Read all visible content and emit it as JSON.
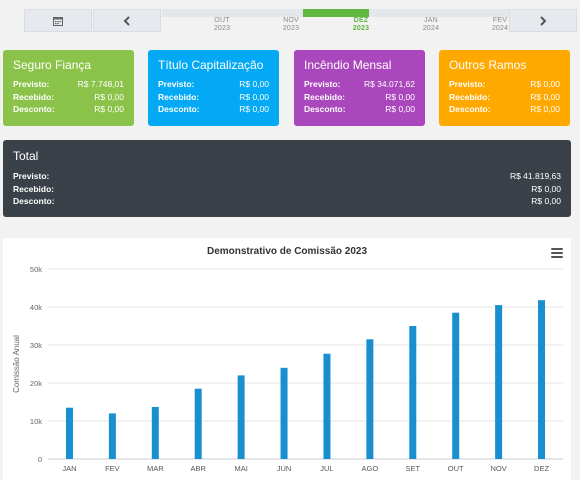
{
  "timeline": {
    "months": [
      {
        "month": "OUT",
        "year": "2023",
        "active": false
      },
      {
        "month": "NOV",
        "year": "2023",
        "active": false
      },
      {
        "month": "DEZ",
        "year": "2023",
        "active": true
      },
      {
        "month": "JAN",
        "year": "2024",
        "active": false
      },
      {
        "month": "FEV",
        "year": "2024",
        "active": false
      }
    ]
  },
  "cards": [
    {
      "title": "Seguro Fiança",
      "color": "#8bc34a",
      "rows": [
        {
          "label": "Previsto:",
          "value": "R$ 7.748,01"
        },
        {
          "label": "Recebido:",
          "value": "R$ 0,00"
        },
        {
          "label": "Desconto:",
          "value": "R$ 0,00"
        }
      ]
    },
    {
      "title": "Título Capitalização",
      "color": "#03a9f4",
      "rows": [
        {
          "label": "Previsto:",
          "value": "R$ 0,00"
        },
        {
          "label": "Recebido:",
          "value": "R$ 0,00"
        },
        {
          "label": "Desconto:",
          "value": "R$ 0,00"
        }
      ]
    },
    {
      "title": "Incêndio Mensal",
      "color": "#ab47bc",
      "rows": [
        {
          "label": "Previsto:",
          "value": "R$ 34.071,62"
        },
        {
          "label": "Recebido:",
          "value": "R$ 0,00"
        },
        {
          "label": "Desconto:",
          "value": "R$ 0,00"
        }
      ]
    },
    {
      "title": "Outros Ramos",
      "color": "#ffa800",
      "rows": [
        {
          "label": "Previsto:",
          "value": "R$ 0,00"
        },
        {
          "label": "Recebido:",
          "value": "R$ 0,00"
        },
        {
          "label": "Desconto:",
          "value": "R$ 0,00"
        }
      ]
    }
  ],
  "total": {
    "title": "Total",
    "color": "#3a4149",
    "rows": [
      {
        "label": "Previsto:",
        "value": "R$ 41.819,63"
      },
      {
        "label": "Recebido:",
        "value": "R$ 0,00"
      },
      {
        "label": "Desconto:",
        "value": "R$ 0,00"
      }
    ]
  },
  "chart_data": {
    "type": "bar",
    "title": "Demonstrativo de Comissão 2023",
    "ylabel": "Comissão Anual",
    "xlabel": "",
    "categories": [
      "JAN",
      "FEV",
      "MAR",
      "ABR",
      "MAI",
      "JUN",
      "JUL",
      "AGO",
      "SET",
      "OUT",
      "NOV",
      "DEZ"
    ],
    "values": [
      13500,
      12000,
      13700,
      18500,
      22000,
      24000,
      27700,
      31500,
      35000,
      38500,
      40500,
      41800
    ],
    "ylim": [
      0,
      50000
    ],
    "yticks": [
      "0",
      "10k",
      "20k",
      "30k",
      "40k",
      "50k"
    ],
    "bar_color": "#1a8fd0",
    "grid": true
  }
}
